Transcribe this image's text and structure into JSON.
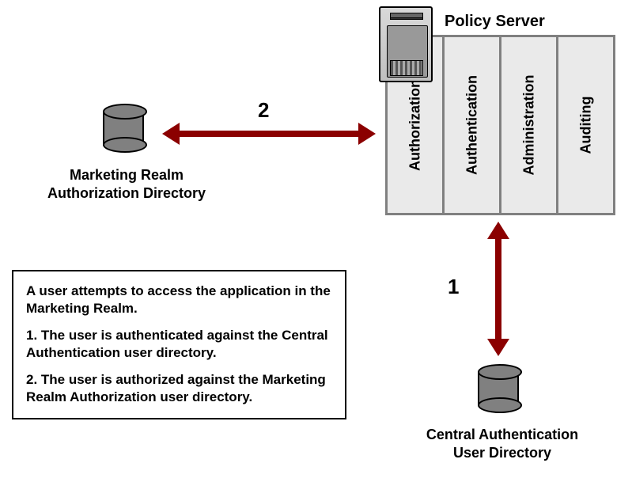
{
  "title": "Policy Server",
  "server_columns": [
    "Authorization",
    "Authentication",
    "Administration",
    "Auditing"
  ],
  "left_db_label_l1": "Marketing Realm",
  "left_db_label_l2": "Authorization Directory",
  "bottom_db_label_l1": "Central Authentication",
  "bottom_db_label_l2": "User Directory",
  "arrow2_num": "2",
  "arrow1_num": "1",
  "desc": {
    "intro": "A user attempts to access the application in the Marketing Realm.",
    "step1": "1. The user is authenticated against the Central Authentication user directory.",
    "step2": "2. The user is authorized against the Marketing Realm Authorization user directory."
  }
}
